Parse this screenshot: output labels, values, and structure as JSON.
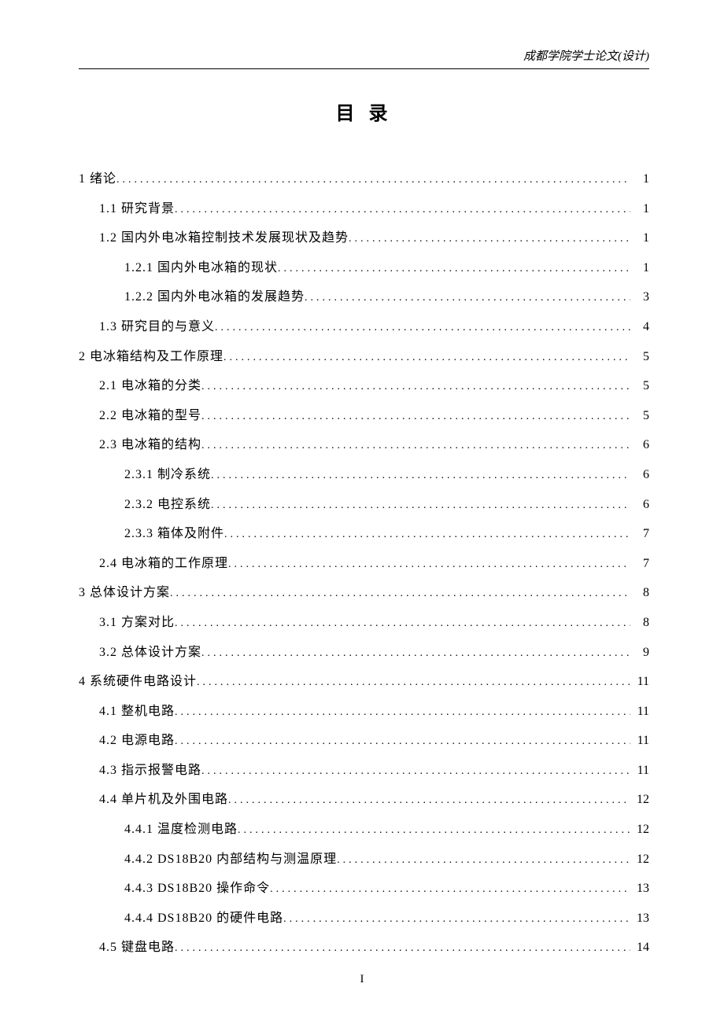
{
  "header": "成都学院学士论文(设计)",
  "title": "目 录",
  "page_number": "I",
  "toc": [
    {
      "level": 1,
      "label": "1 绪论",
      "page": "1"
    },
    {
      "level": 2,
      "label": "1.1 研究背景",
      "page": "1"
    },
    {
      "level": 2,
      "label": "1.2 国内外电冰箱控制技术发展现状及趋势",
      "page": "1"
    },
    {
      "level": 3,
      "label": "1.2.1 国内外电冰箱的现状",
      "page": "1"
    },
    {
      "level": 3,
      "label": "1.2.2 国内外电冰箱的发展趋势",
      "page": "3"
    },
    {
      "level": 2,
      "label": "1.3 研究目的与意义",
      "page": "4"
    },
    {
      "level": 1,
      "label": "2 电冰箱结构及工作原理",
      "page": "5"
    },
    {
      "level": 2,
      "label": "2.1 电冰箱的分类",
      "page": "5"
    },
    {
      "level": 2,
      "label": "2.2 电冰箱的型号",
      "page": "5"
    },
    {
      "level": 2,
      "label": "2.3 电冰箱的结构",
      "page": "6"
    },
    {
      "level": 3,
      "label": "2.3.1 制冷系统",
      "page": "6"
    },
    {
      "level": 3,
      "label": "2.3.2 电控系统",
      "page": "6"
    },
    {
      "level": 3,
      "label": "2.3.3 箱体及附件",
      "page": "7"
    },
    {
      "level": 2,
      "label": "2.4 电冰箱的工作原理",
      "page": "7"
    },
    {
      "level": 1,
      "label": "3 总体设计方案",
      "page": "8"
    },
    {
      "level": 2,
      "label": "3.1 方案对比",
      "page": "8"
    },
    {
      "level": 2,
      "label": "3.2 总体设计方案",
      "page": "9"
    },
    {
      "level": 1,
      "label": "4 系统硬件电路设计",
      "page": "11"
    },
    {
      "level": 2,
      "label": "4.1 整机电路",
      "page": "11"
    },
    {
      "level": 2,
      "label": "4.2 电源电路",
      "page": "11"
    },
    {
      "level": 2,
      "label": "4.3 指示报警电路",
      "page": "11"
    },
    {
      "level": 2,
      "label": "4.4 单片机及外围电路",
      "page": "12"
    },
    {
      "level": 3,
      "label": "4.4.1 温度检测电路",
      "page": "12"
    },
    {
      "level": 3,
      "label": "4.4.2 DS18B20 内部结构与测温原理",
      "page": "12"
    },
    {
      "level": 3,
      "label": "4.4.3 DS18B20 操作命令",
      "page": "13"
    },
    {
      "level": 3,
      "label": "4.4.4 DS18B20 的硬件电路",
      "page": "13"
    },
    {
      "level": 2,
      "label": "4.5 键盘电路",
      "page": "14"
    }
  ]
}
